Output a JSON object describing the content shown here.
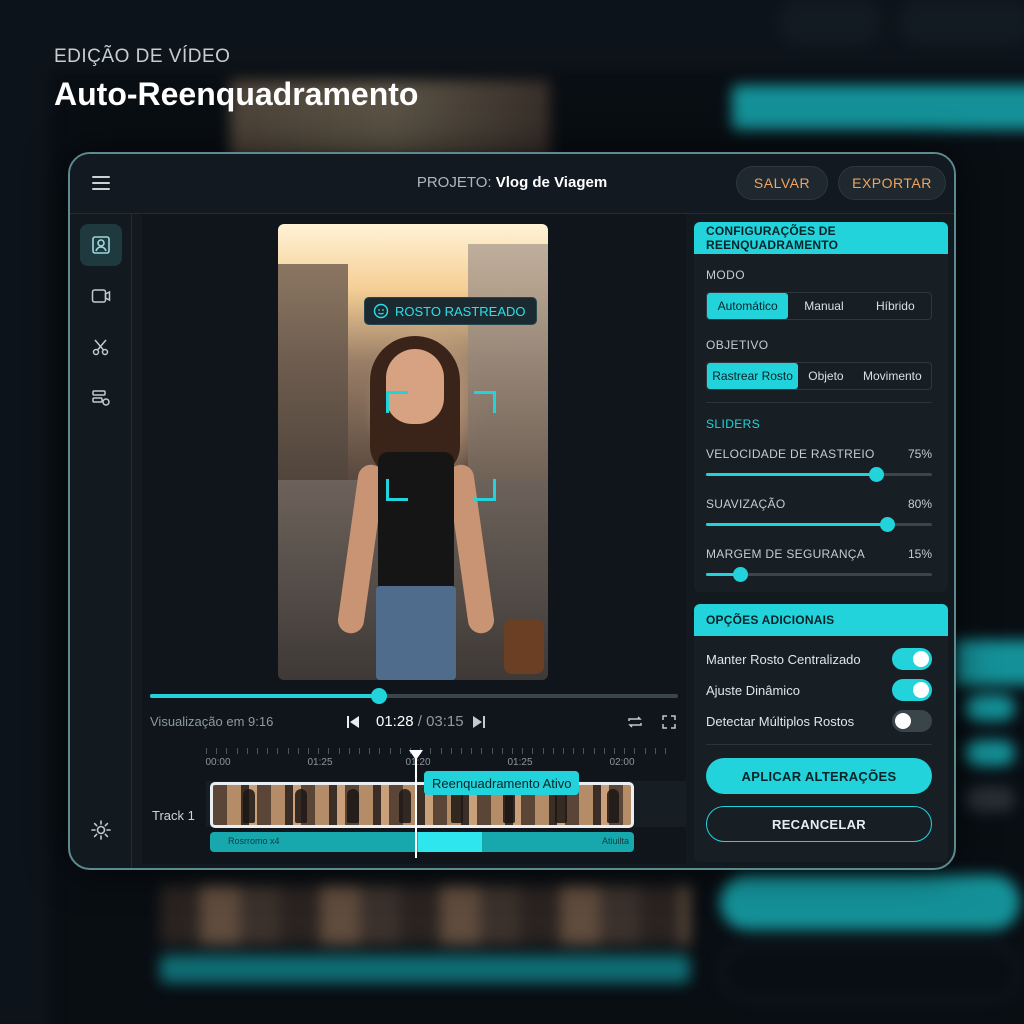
{
  "header": {
    "kicker": "EDIÇÃO DE VÍDEO",
    "title": "Auto-Reenquadramento"
  },
  "topbar": {
    "project_prefix": "PROJETO:",
    "project_name": "Vlog de Viagem",
    "save_label": "SALVAR",
    "export_label": "EXPORTAR"
  },
  "leftnav": {
    "items": [
      "reframe-icon",
      "video-icon",
      "cut-icon",
      "layers-icon"
    ],
    "settings": "gear-icon"
  },
  "preview": {
    "tracked_label": "ROSTO RASTREADO",
    "progress": 0.434,
    "view_label": "Visualização em 9:16",
    "current_time": "01:28",
    "separator": " / ",
    "total_time": "03:15"
  },
  "timeline": {
    "tick_labels": [
      "00:00",
      "01:25",
      "01:20",
      "01:25",
      "02:00"
    ],
    "track_label": "Track 1",
    "reframe_tag": "Reenquadramento Ativo",
    "wave_left_label": "Rosrromo x4",
    "wave_right_label": "Atiuilta"
  },
  "config": {
    "title": "CONFIGURAÇÕES DE REENQUADRAMENTO",
    "mode_label": "MODO",
    "modes": [
      "Automático",
      "Manual",
      "Híbrido"
    ],
    "mode_selected": 0,
    "target_label": "OBJETIVO",
    "targets": [
      "Rastrear Rosto",
      "Objeto",
      "Movimento"
    ],
    "target_selected": 0,
    "sliders_label": "SLIDERS",
    "sliders": [
      {
        "name": "VELOCIDADE DE RASTREIO",
        "value_text": "75%",
        "value": 0.75
      },
      {
        "name": "SUAVIZAÇÃO",
        "value_text": "80%",
        "value": 0.8
      },
      {
        "name": "MARGEM DE SEGURANÇA",
        "value_text": "15%",
        "value": 0.15
      }
    ]
  },
  "options": {
    "title": "OPÇÕES ADICIONAIS",
    "items": [
      {
        "name": "Manter Rosto Centralizado",
        "on": true
      },
      {
        "name": "Ajuste Dinâmico",
        "on": true
      },
      {
        "name": "Detectar Múltiplos Rostos",
        "on": false
      }
    ],
    "apply_label": "APLICAR ALTERAÇÕES",
    "cancel_label": "RECANCELAR"
  },
  "colors": {
    "accent": "#22d3dc",
    "button_text": "#f0a45c",
    "panel": "#171f25"
  }
}
